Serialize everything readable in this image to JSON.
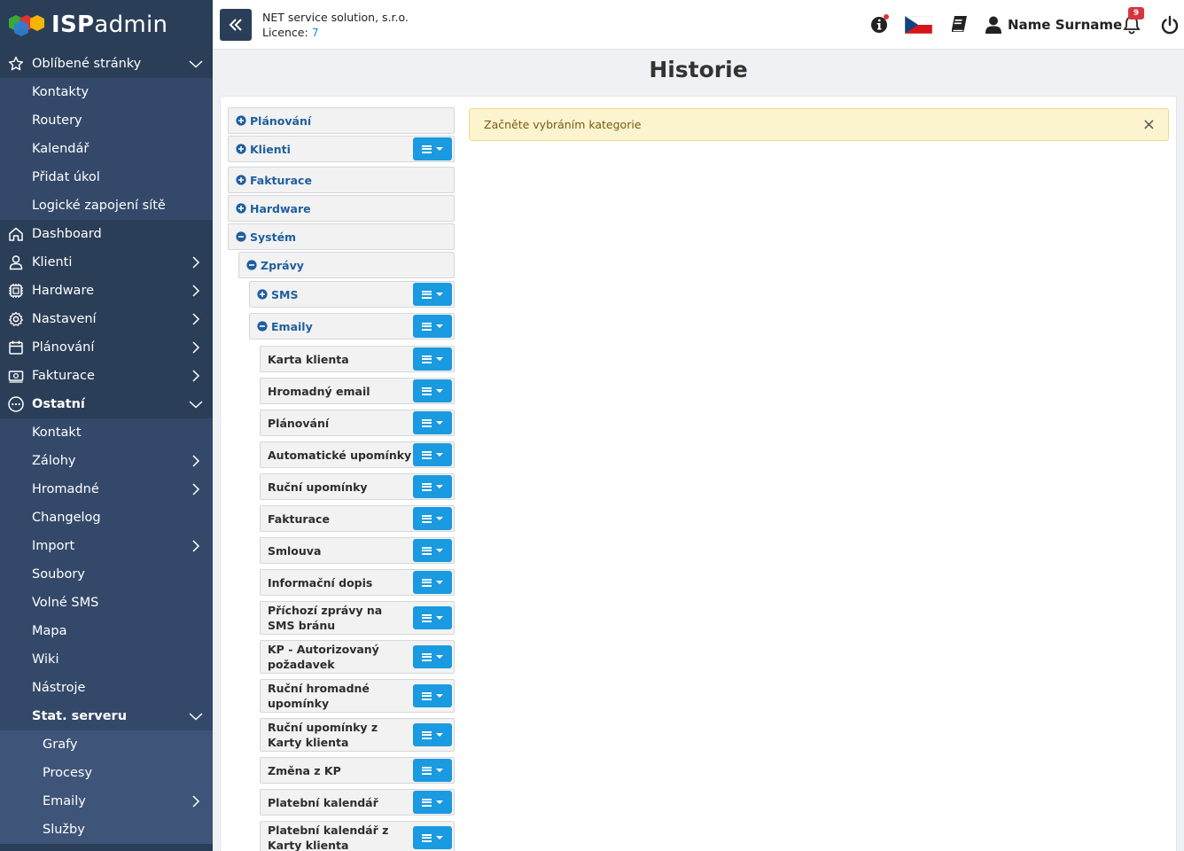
{
  "logo": {
    "brand_bold": "ISP",
    "brand_rest": "admin"
  },
  "sidebar": {
    "favorites": {
      "label": "Oblíbené stránky",
      "items": [
        "Kontakty",
        "Routery",
        "Kalendář",
        "Přidat úkol",
        "Logické zapojení sítě"
      ]
    },
    "main": [
      {
        "label": "Dashboard",
        "icon": "home-icon"
      },
      {
        "label": "Klienti",
        "icon": "user-icon"
      },
      {
        "label": "Hardware",
        "icon": "chip-icon"
      },
      {
        "label": "Nastavení",
        "icon": "gear-icon"
      },
      {
        "label": "Plánování",
        "icon": "calendar-icon"
      },
      {
        "label": "Fakturace",
        "icon": "money-icon"
      },
      {
        "label": "Ostatní",
        "icon": "more-icon"
      }
    ],
    "ostatni_items": [
      "Kontakt",
      "Zálohy",
      "Hromadné",
      "Changelog",
      "Import",
      "Soubory",
      "Volné SMS",
      "Mapa",
      "Wiki",
      "Nástroje",
      "Stat. serveru"
    ],
    "stat_items": [
      "Grafy",
      "Procesy",
      "Emaily",
      "Služby"
    ]
  },
  "header": {
    "company": "NET service solution, s.r.o.",
    "licence_label": "Licence:",
    "licence_value": "7",
    "user_name": "Name Surname",
    "notification_count": "9"
  },
  "page": {
    "title": "Historie"
  },
  "alert": {
    "text": "Začněte vybráním kategorie",
    "close": "×"
  },
  "tree": {
    "planovani": "Plánování",
    "klienti": "Klienti",
    "fakturace": "Fakturace",
    "hardware": "Hardware",
    "system": "Systém",
    "zpravy": "Zprávy",
    "sms": "SMS",
    "emaily": "Emaily",
    "email_items": [
      "Karta klienta",
      "Hromadný email",
      "Plánování",
      "Automatické upomínky",
      "Ruční upomínky",
      "Fakturace",
      "Smlouva",
      "Informační dopis",
      "Příchozí zprávy na SMS bránu",
      "KP - Autorizovaný požadavek",
      "Ruční hromadné upomínky",
      "Ruční upomínky z Karty klienta",
      "Změna z KP",
      "Platební kalendář",
      "Platební kalendář z Karty klienta"
    ]
  },
  "colors": {
    "sidebar": "#2b3e58",
    "accent": "#1a9ae0",
    "alert_bg": "#fcf3cf",
    "badge": "#d9333f"
  }
}
